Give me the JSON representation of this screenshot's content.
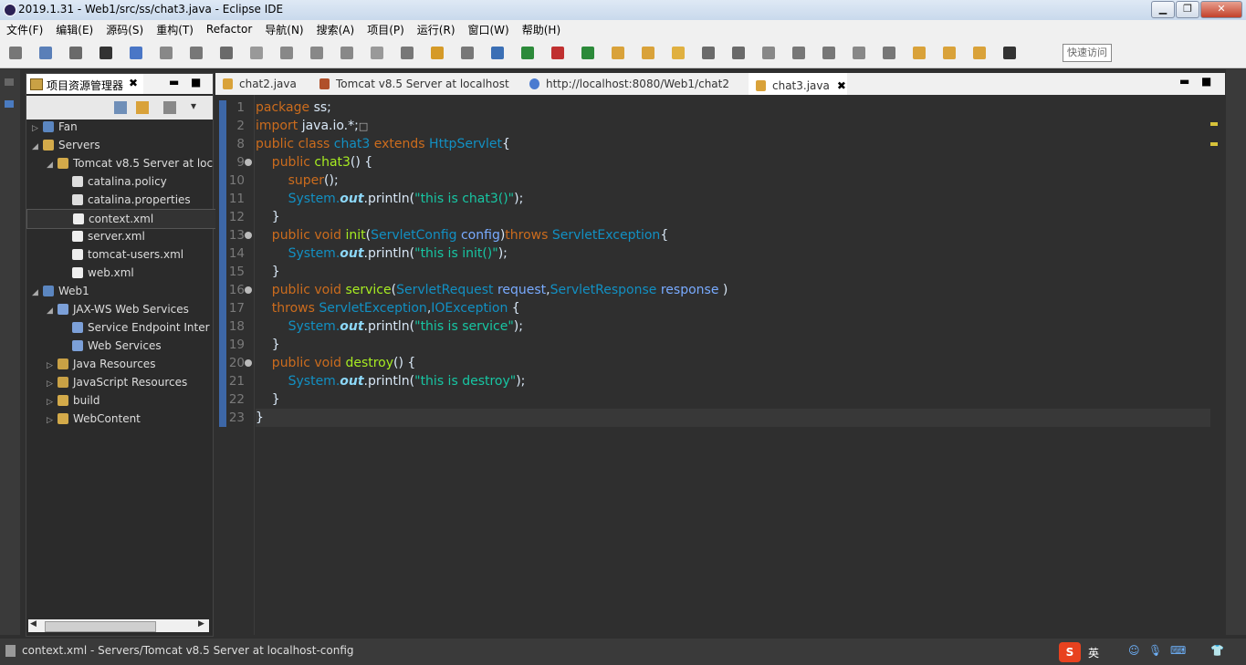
{
  "window": {
    "title": "2019.1.31 - Web1/src/ss/chat3.java - Eclipse IDE"
  },
  "menu": [
    "文件(F)",
    "编辑(E)",
    "源码(S)",
    "重构(T)",
    "Refactor",
    "导航(N)",
    "搜索(A)",
    "项目(P)",
    "运行(R)",
    "窗口(W)",
    "帮助(H)"
  ],
  "toolbar": {
    "quick_access": "快速访问"
  },
  "explorer": {
    "title": "项目资源管理器",
    "items": [
      {
        "label": "Fan",
        "indent": 0,
        "arrow": "▷",
        "kind": "project"
      },
      {
        "label": "Servers",
        "indent": 0,
        "arrow": "◢",
        "kind": "folder"
      },
      {
        "label": "Tomcat v8.5 Server at loc",
        "indent": 1,
        "arrow": "◢",
        "kind": "folder"
      },
      {
        "label": "catalina.policy",
        "indent": 2,
        "arrow": "",
        "kind": "file"
      },
      {
        "label": "catalina.properties",
        "indent": 2,
        "arrow": "",
        "kind": "file"
      },
      {
        "label": "context.xml",
        "indent": 2,
        "arrow": "",
        "kind": "xml",
        "selected": true
      },
      {
        "label": "server.xml",
        "indent": 2,
        "arrow": "",
        "kind": "xml"
      },
      {
        "label": "tomcat-users.xml",
        "indent": 2,
        "arrow": "",
        "kind": "xml"
      },
      {
        "label": "web.xml",
        "indent": 2,
        "arrow": "",
        "kind": "xml"
      },
      {
        "label": "Web1",
        "indent": 0,
        "arrow": "◢",
        "kind": "project"
      },
      {
        "label": "JAX-WS Web Services",
        "indent": 1,
        "arrow": "◢",
        "kind": "ws"
      },
      {
        "label": "Service Endpoint Inter",
        "indent": 2,
        "arrow": "",
        "kind": "ws"
      },
      {
        "label": "Web Services",
        "indent": 2,
        "arrow": "",
        "kind": "ws"
      },
      {
        "label": "Java Resources",
        "indent": 1,
        "arrow": "▷",
        "kind": "jres"
      },
      {
        "label": "JavaScript Resources",
        "indent": 1,
        "arrow": "▷",
        "kind": "jsres"
      },
      {
        "label": "build",
        "indent": 1,
        "arrow": "▷",
        "kind": "folder"
      },
      {
        "label": "WebContent",
        "indent": 1,
        "arrow": "▷",
        "kind": "folder"
      }
    ]
  },
  "tabs": [
    {
      "label": "chat2.java"
    },
    {
      "label": "Tomcat v8.5 Server at localhost"
    },
    {
      "label": "http://localhost:8080/Web1/chat2"
    },
    {
      "label": "chat3.java",
      "active": true,
      "close": "✖"
    }
  ],
  "code": {
    "line_numbers": [
      "1",
      "2",
      "8",
      "9",
      "10",
      "11",
      "12",
      "13",
      "14",
      "15",
      "16",
      "17",
      "18",
      "19",
      "20",
      "21",
      "22",
      "23"
    ],
    "lines": [
      [
        {
          "t": "package ",
          "c": "kw"
        },
        {
          "t": "ss;"
        }
      ],
      [
        {
          "t": "import ",
          "c": "kw"
        },
        {
          "t": "java.io.*;"
        },
        {
          "t": "□",
          "c": "box"
        }
      ],
      [
        {
          "t": "public class ",
          "c": "kw"
        },
        {
          "t": "chat3",
          "c": "cls"
        },
        {
          "t": " extends ",
          "c": "kw"
        },
        {
          "t": "HttpServlet",
          "c": "cls"
        },
        {
          "t": "{"
        }
      ],
      [
        {
          "t": "    public ",
          "c": "kw"
        },
        {
          "t": "chat3",
          "c": "mth"
        },
        {
          "t": "() {"
        }
      ],
      [
        {
          "t": "        "
        },
        {
          "t": "super",
          "c": "kw"
        },
        {
          "t": "();"
        }
      ],
      [
        {
          "t": "        "
        },
        {
          "t": "System.",
          "c": "cls"
        },
        {
          "t": "out",
          "c": "ital"
        },
        {
          "t": ".println("
        },
        {
          "t": "\"this is chat3()\"",
          "c": "str"
        },
        {
          "t": ");"
        }
      ],
      [
        {
          "t": "    }"
        }
      ],
      [
        {
          "t": "    public void ",
          "c": "kw"
        },
        {
          "t": "init",
          "c": "mth"
        },
        {
          "t": "("
        },
        {
          "t": "ServletConfig ",
          "c": "cls"
        },
        {
          "t": "config",
          "c": "par"
        },
        {
          "t": ")"
        },
        {
          "t": "throws ",
          "c": "kw"
        },
        {
          "t": "ServletException",
          "c": "cls"
        },
        {
          "t": "{"
        }
      ],
      [
        {
          "t": "        "
        },
        {
          "t": "System.",
          "c": "cls"
        },
        {
          "t": "out",
          "c": "ital"
        },
        {
          "t": ".println("
        },
        {
          "t": "\"this is init()\"",
          "c": "str"
        },
        {
          "t": ");"
        }
      ],
      [
        {
          "t": "    }"
        }
      ],
      [
        {
          "t": "    public void ",
          "c": "kw"
        },
        {
          "t": "service",
          "c": "mth"
        },
        {
          "t": "("
        },
        {
          "t": "ServletRequest ",
          "c": "cls"
        },
        {
          "t": "request",
          "c": "par"
        },
        {
          "t": ","
        },
        {
          "t": "ServletResponse ",
          "c": "cls"
        },
        {
          "t": "response",
          "c": "par"
        },
        {
          "t": " )"
        }
      ],
      [
        {
          "t": "    throws ",
          "c": "kw"
        },
        {
          "t": "ServletException",
          "c": "cls"
        },
        {
          "t": ","
        },
        {
          "t": "IOException",
          "c": "cls"
        },
        {
          "t": " {"
        }
      ],
      [
        {
          "t": "        "
        },
        {
          "t": "System.",
          "c": "cls"
        },
        {
          "t": "out",
          "c": "ital"
        },
        {
          "t": ".println("
        },
        {
          "t": "\"this is service\"",
          "c": "str"
        },
        {
          "t": ");"
        }
      ],
      [
        {
          "t": "    }"
        }
      ],
      [
        {
          "t": "    public void ",
          "c": "kw"
        },
        {
          "t": "destroy",
          "c": "mth"
        },
        {
          "t": "() {"
        }
      ],
      [
        {
          "t": "        "
        },
        {
          "t": "System.",
          "c": "cls"
        },
        {
          "t": "out",
          "c": "ital"
        },
        {
          "t": ".println("
        },
        {
          "t": "\"this is destroy\"",
          "c": "str"
        },
        {
          "t": ");"
        }
      ],
      [
        {
          "t": "    }"
        }
      ],
      [
        {
          "t": "}"
        }
      ]
    ]
  },
  "status": {
    "text": "context.xml - Servers/Tomcat v8.5 Server at localhost-config",
    "ime": "英"
  },
  "colors": {
    "keyword": "#cc6c1d",
    "type": "#1290c3",
    "method": "#a7ec21",
    "string": "#17c6a3",
    "background": "#2f2f2f"
  }
}
